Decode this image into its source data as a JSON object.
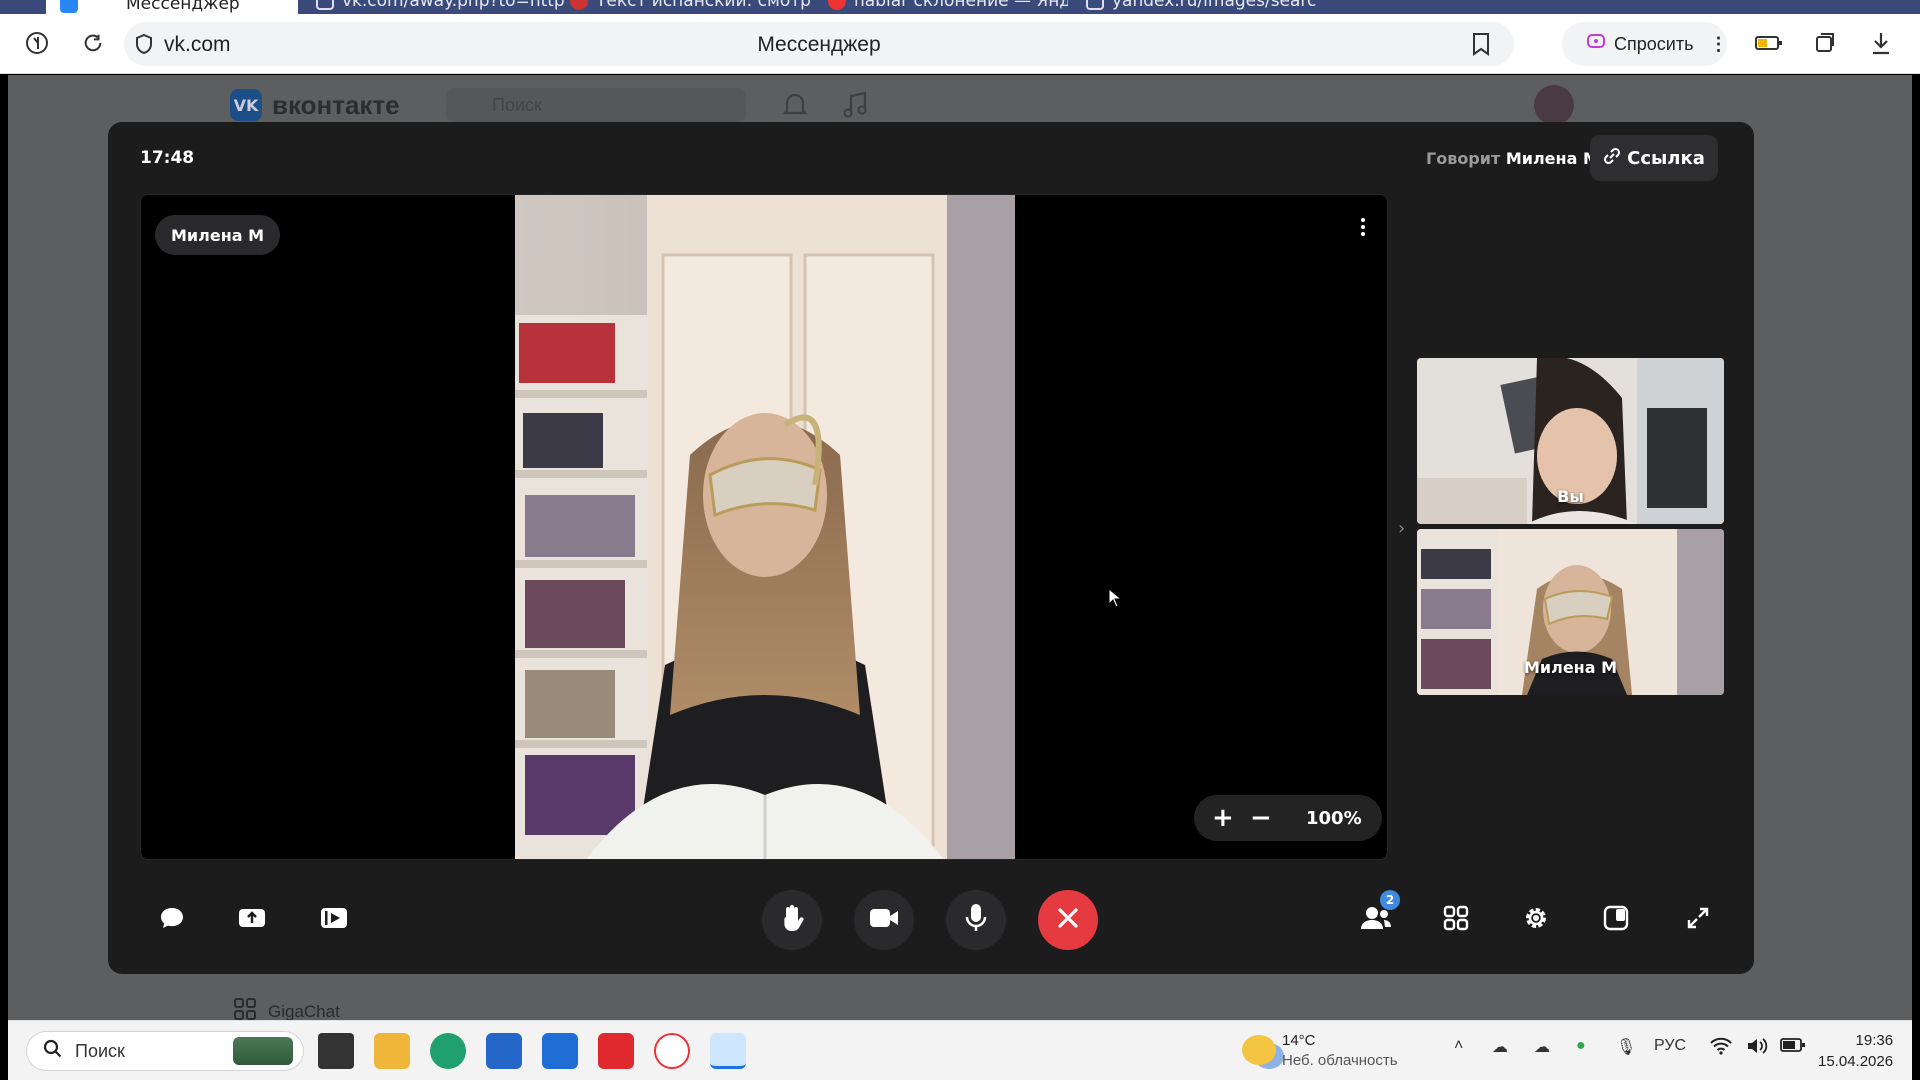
{
  "browser": {
    "tabs": [
      {
        "label": "Мессенджер",
        "active": true
      },
      {
        "label": "vk.com/away.php?to=http",
        "active": false
      },
      {
        "label": "Текст испанский: смотри",
        "active": false
      },
      {
        "label": "hablar склонение — Янде",
        "active": false
      },
      {
        "label": "yandex.ru/images/search?",
        "active": false
      }
    ],
    "url": "vk.com",
    "page_title": "Мессенджер",
    "ask_label": "Спросить"
  },
  "vk": {
    "logo_text": "VK",
    "brand": "вконтакте",
    "search_placeholder": "Поиск",
    "gigachat_label": "GigaChat"
  },
  "call": {
    "time": "17:48",
    "speaking_prefix": "Говорит",
    "speaking_name": "Милена М",
    "link_button": "Ссылка",
    "main_participant": "Милена М",
    "zoom_percent": "100%",
    "zoom_plus": "+",
    "zoom_minus": "−",
    "participants_count": "2",
    "thumbnails": [
      {
        "label": "Вы"
      },
      {
        "label": "Милена М"
      }
    ],
    "end_call_color": "#e53a3f"
  },
  "taskbar": {
    "search_placeholder": "Поиск",
    "weather_temp": "14°C",
    "weather_desc": "Неб. облачность",
    "language": "РУС",
    "time": "19:36",
    "date": "15.04.2026"
  }
}
